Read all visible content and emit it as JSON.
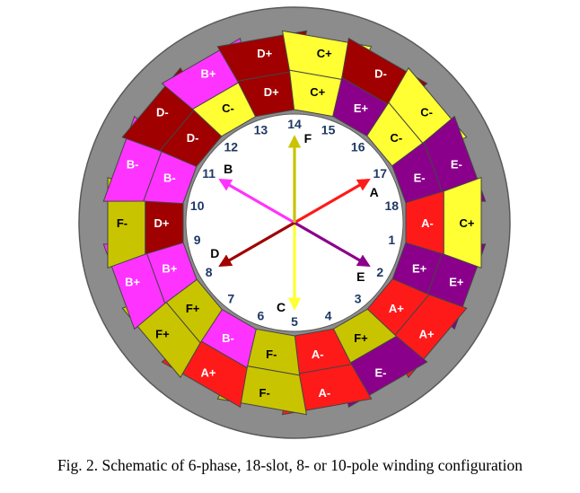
{
  "figure": {
    "caption": "Fig. 2.  Schematic of 6-phase, 18-slot, 8- or 10-pole winding configuration"
  },
  "colors": {
    "stator": "#8c8c8c",
    "stator_edge": "#5a5a5a",
    "bore": "#ffffff",
    "slot_number": "#1f3864",
    "phase_label": "#000000",
    "A": "#ff1a1a",
    "B": "#ff33ff",
    "C": "#ffff33",
    "D": "#a00000",
    "E": "#8b008b",
    "F": "#c9c400"
  },
  "slots": [
    {
      "number": "1",
      "outer": {
        "label": "E+",
        "phase": "E"
      },
      "inner": {
        "label": "E+",
        "phase": "E"
      }
    },
    {
      "number": "2",
      "outer": {
        "label": "A+",
        "phase": "A"
      },
      "inner": {
        "label": "A+",
        "phase": "A"
      }
    },
    {
      "number": "3",
      "outer": {
        "label": "E-",
        "phase": "E"
      },
      "inner": {
        "label": "F+",
        "phase": "F"
      }
    },
    {
      "number": "4",
      "outer": {
        "label": "A-",
        "phase": "A"
      },
      "inner": {
        "label": "A-",
        "phase": "A"
      }
    },
    {
      "number": "5",
      "outer": {
        "label": "F-",
        "phase": "F"
      },
      "inner": {
        "label": "F-",
        "phase": "F"
      }
    },
    {
      "number": "6",
      "outer": {
        "label": "A+",
        "phase": "A"
      },
      "inner": {
        "label": "B-",
        "phase": "B"
      }
    },
    {
      "number": "7",
      "outer": {
        "label": "F+",
        "phase": "F"
      },
      "inner": {
        "label": "F+",
        "phase": "F"
      }
    },
    {
      "number": "8",
      "outer": {
        "label": "B+",
        "phase": "B"
      },
      "inner": {
        "label": "B+",
        "phase": "B"
      }
    },
    {
      "number": "9",
      "outer": {
        "label": "F-",
        "phase": "F"
      },
      "inner": {
        "label": "D+",
        "phase": "D"
      }
    },
    {
      "number": "10",
      "outer": {
        "label": "B-",
        "phase": "B"
      },
      "inner": {
        "label": "B-",
        "phase": "B"
      }
    },
    {
      "number": "11",
      "outer": {
        "label": "D-",
        "phase": "D"
      },
      "inner": {
        "label": "D-",
        "phase": "D"
      }
    },
    {
      "number": "12",
      "outer": {
        "label": "B+",
        "phase": "B"
      },
      "inner": {
        "label": "C-",
        "phase": "C"
      }
    },
    {
      "number": "13",
      "outer": {
        "label": "D+",
        "phase": "D"
      },
      "inner": {
        "label": "D+",
        "phase": "D"
      }
    },
    {
      "number": "14",
      "outer": {
        "label": "C+",
        "phase": "C"
      },
      "inner": {
        "label": "C+",
        "phase": "C"
      }
    },
    {
      "number": "15",
      "outer": {
        "label": "D-",
        "phase": "D"
      },
      "inner": {
        "label": "E+",
        "phase": "E"
      }
    },
    {
      "number": "16",
      "outer": {
        "label": "C-",
        "phase": "C"
      },
      "inner": {
        "label": "C-",
        "phase": "C"
      }
    },
    {
      "number": "17",
      "outer": {
        "label": "E-",
        "phase": "E"
      },
      "inner": {
        "label": "E-",
        "phase": "E"
      }
    },
    {
      "number": "18",
      "outer": {
        "label": "C+",
        "phase": "C"
      },
      "inner": {
        "label": "A-",
        "phase": "A"
      }
    }
  ],
  "phasors": [
    {
      "label": "A",
      "phase": "A",
      "angle_deg": 30
    },
    {
      "label": "B",
      "phase": "B",
      "angle_deg": 150
    },
    {
      "label": "C",
      "phase": "C",
      "angle_deg": 270
    },
    {
      "label": "D",
      "phase": "D",
      "angle_deg": 210
    },
    {
      "label": "E",
      "phase": "E",
      "angle_deg": 330
    },
    {
      "label": "F",
      "phase": "F",
      "angle_deg": 90
    }
  ]
}
